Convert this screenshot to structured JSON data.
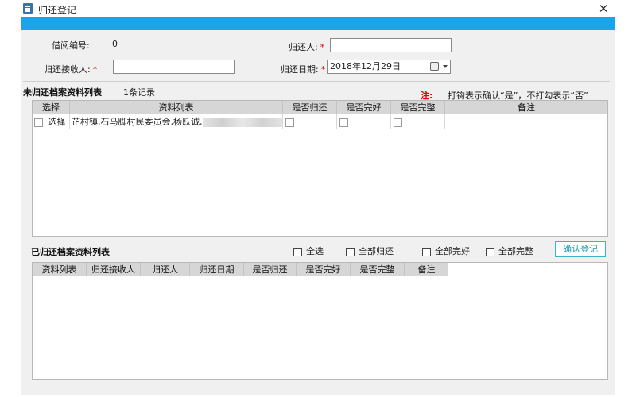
{
  "window": {
    "title": "归还登记",
    "close_glyph": "✕"
  },
  "form": {
    "borrow_no_label": "借阅编号:",
    "borrow_no_value": "0",
    "returner_label": "归还人:",
    "returner_value": "",
    "receiver_label": "归还接收人:",
    "receiver_value": "",
    "return_date_label": "归还日期:",
    "return_date_value": "2018年12月29日",
    "required_mark": "*"
  },
  "unreturned": {
    "title": "未归还档案资料列表",
    "count_text": "1条记录",
    "hint_label": "注:",
    "hint_text": "打钩表示确认“是”，不打勾表示“否”",
    "columns": [
      "选择",
      "资料列表",
      "是否归还",
      "是否完好",
      "是否完整",
      "备注"
    ],
    "rows": [
      {
        "select_label": "选择",
        "material": "芷村镇,石马脚村民委员会,杨跃诚,",
        "returned": false,
        "intact": false,
        "complete": false,
        "remark": ""
      }
    ]
  },
  "returned": {
    "title": "已归还档案资料列表",
    "select_all": "全选",
    "all_returned": "全部归还",
    "all_intact": "全部完好",
    "all_complete": "全部完整",
    "confirm_button": "确认登记",
    "columns": [
      "资料列表",
      "归还接收人",
      "归还人",
      "归还日期",
      "是否归还",
      "是否完好",
      "是否完整",
      "备注"
    ]
  },
  "icons": {
    "app": "document-icon",
    "calendar": "calendar-icon",
    "dropdown": "chevron-down-icon"
  },
  "colors": {
    "title_band": "#1ca3e8",
    "required": "#d00000",
    "confirm_border": "#39b5c8"
  }
}
